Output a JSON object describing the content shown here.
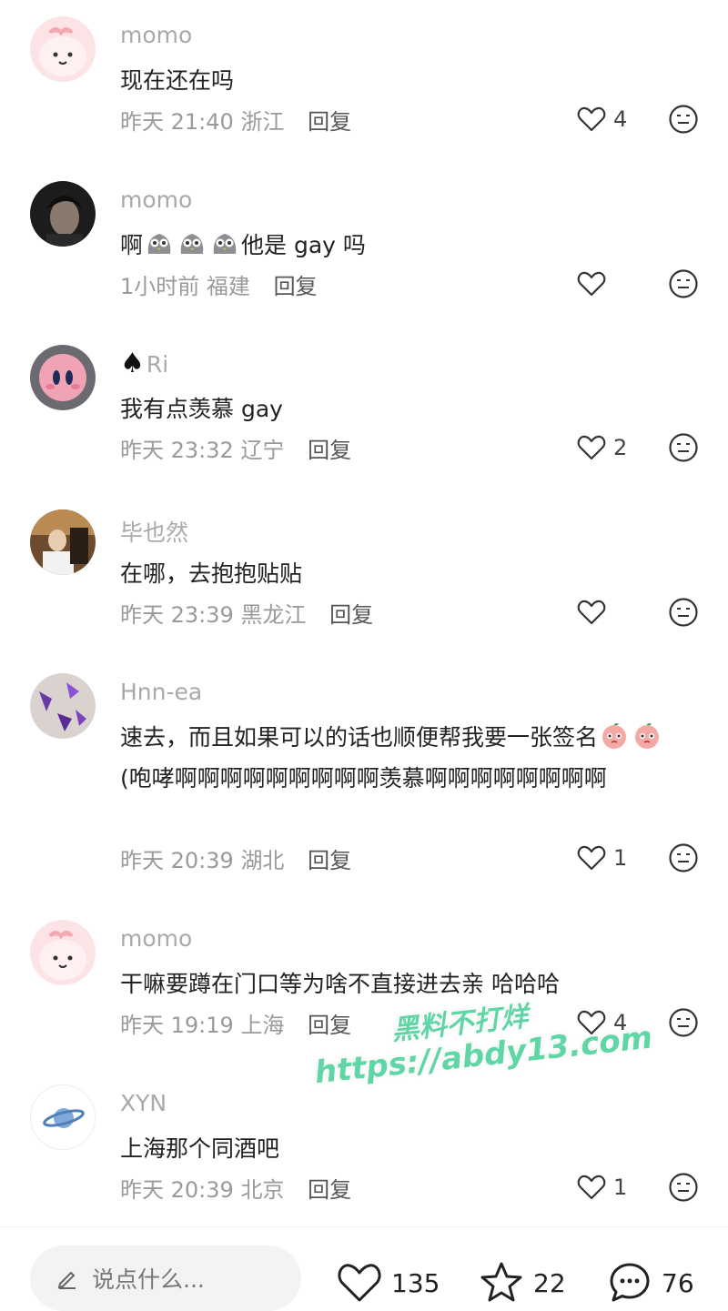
{
  "comments": [
    {
      "username": "momo",
      "text": "现在还在吗",
      "time": "昨天 21:40",
      "location": "浙江",
      "reply": "回复",
      "likes": "4"
    },
    {
      "username": "momo",
      "text_before": "啊",
      "text_after": "他是 gay 吗",
      "time": "1小时前",
      "location": "福建",
      "reply": "回复",
      "likes": ""
    },
    {
      "username": "Ri",
      "text": "我有点羡慕 gay",
      "time": "昨天 23:32",
      "location": "辽宁",
      "reply": "回复",
      "likes": "2"
    },
    {
      "username": "毕也然",
      "text": "在哪，去抱抱贴贴",
      "time": "昨天 23:39",
      "location": "黑龙江",
      "reply": "回复",
      "likes": ""
    },
    {
      "username": "Hnn-ea",
      "text_part1": "速去，而且如果可以的话也顺便帮我要一张签名",
      "text_part2": "(咆哮啊啊啊啊啊啊啊啊啊羡慕啊啊啊啊啊啊啊啊",
      "time": "昨天 20:39",
      "location": "湖北",
      "reply": "回复",
      "likes": "1"
    },
    {
      "username": "momo",
      "text": "干嘛要蹲在门口等为啥不直接进去亲 哈哈哈",
      "time": "昨天 19:19",
      "location": "上海",
      "reply": "回复",
      "likes": "4"
    },
    {
      "username": "XYN",
      "text": "上海那个同酒吧",
      "time": "昨天 20:39",
      "location": "北京",
      "reply": "回复",
      "likes": "1"
    }
  ],
  "bottom_bar": {
    "placeholder": "说点什么...",
    "likes": "135",
    "favorites": "22",
    "comments": "76"
  },
  "watermark": {
    "line1": "黑料不打烊",
    "line2": "https://abdy13.com"
  },
  "colors": {
    "accent": "#61d6a5",
    "username": "#a9a9a9",
    "meta": "#9a9a9a"
  }
}
